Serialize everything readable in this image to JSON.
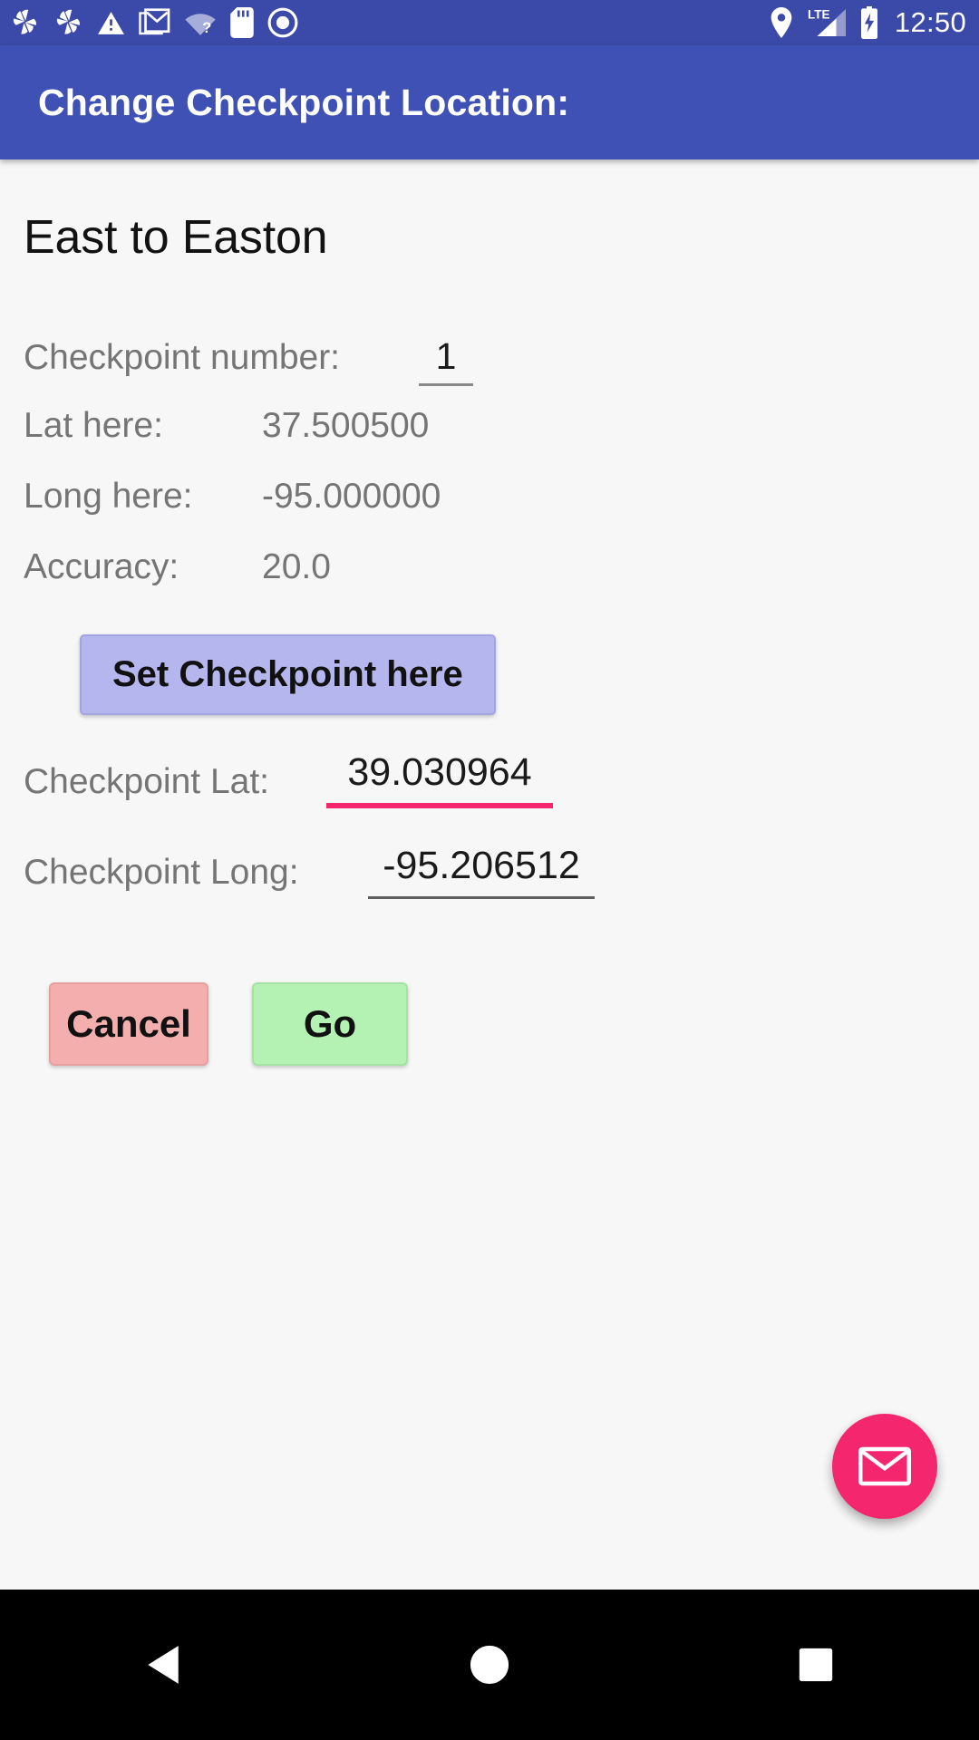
{
  "status_bar": {
    "background_color": "#3b4aa8",
    "left_icons": [
      {
        "name": "pinwheel-icon"
      },
      {
        "name": "pinwheel-icon-2"
      },
      {
        "name": "warning-triangle-icon"
      },
      {
        "name": "gmail-icon"
      },
      {
        "name": "wifi-question-icon"
      },
      {
        "name": "sd-card-icon"
      },
      {
        "name": "record-circle-icon"
      }
    ],
    "right_icons": [
      {
        "name": "location-pin-icon"
      },
      {
        "name": "lte-signal-icon",
        "label": "LTE"
      },
      {
        "name": "battery-charging-icon"
      }
    ],
    "clock": "12:50"
  },
  "app_bar": {
    "title": "Change Checkpoint Location:",
    "background_color": "#3f51b5",
    "text_color": "#ffffff"
  },
  "content": {
    "heading": "East to Easton",
    "checkpoint_number": {
      "label": "Checkpoint number:",
      "value": "1"
    },
    "readings": [
      {
        "label": "Lat here:",
        "value": "37.500500"
      },
      {
        "label": "Long here:",
        "value": "-95.000000"
      },
      {
        "label": "Accuracy:",
        "value": "20.0"
      }
    ],
    "set_checkpoint_button": {
      "label": "Set Checkpoint here",
      "background_color": "#b6b6ef"
    },
    "checkpoint_lat": {
      "label": "Checkpoint Lat:",
      "value": "39.030964",
      "underline_color": "#f4276e",
      "focused": true
    },
    "checkpoint_long": {
      "label": "Checkpoint Long:",
      "value": "-95.206512",
      "underline_color": "#5f5f5f",
      "focused": false
    },
    "cancel_button": {
      "label": "Cancel",
      "background_color": "#f5aeae"
    },
    "go_button": {
      "label": "Go",
      "background_color": "#b4f2b4"
    },
    "fab": {
      "name": "envelope-icon",
      "background_color": "#f4276e"
    }
  },
  "nav_bar": {
    "background_color": "#000000",
    "buttons": [
      {
        "name": "back-button"
      },
      {
        "name": "home-button"
      },
      {
        "name": "recents-button"
      }
    ]
  }
}
